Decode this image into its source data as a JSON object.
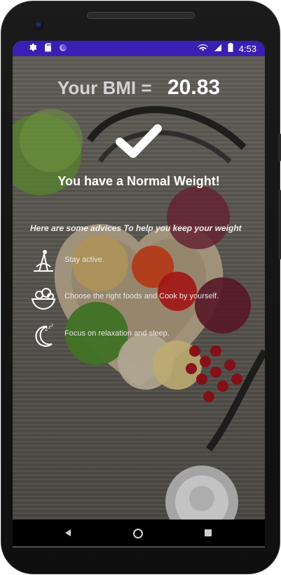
{
  "status_bar": {
    "time": "4:53",
    "left_icons": [
      "gear-icon",
      "sd-card-icon",
      "circle-icon"
    ],
    "right_icons": [
      "wifi-icon",
      "signal-icon",
      "battery-icon"
    ]
  },
  "result": {
    "label": "Your BMI =",
    "value": "20.83",
    "message": "You have a Normal Weight!"
  },
  "advice": {
    "title": "Here are some advices To help you keep your weight",
    "items": [
      {
        "icon": "exercise-icon",
        "text": "Stay active."
      },
      {
        "icon": "salad-bowl-icon",
        "text": "Choose the right foods and Cook by yourself."
      },
      {
        "icon": "moon-sleep-icon",
        "text": "Focus on relaxation and sleep."
      }
    ]
  },
  "nav": {
    "buttons": [
      "back-icon",
      "home-icon",
      "recents-icon"
    ]
  },
  "colors": {
    "status_bar": "#3a1fb4",
    "text_primary": "#ffffff"
  }
}
